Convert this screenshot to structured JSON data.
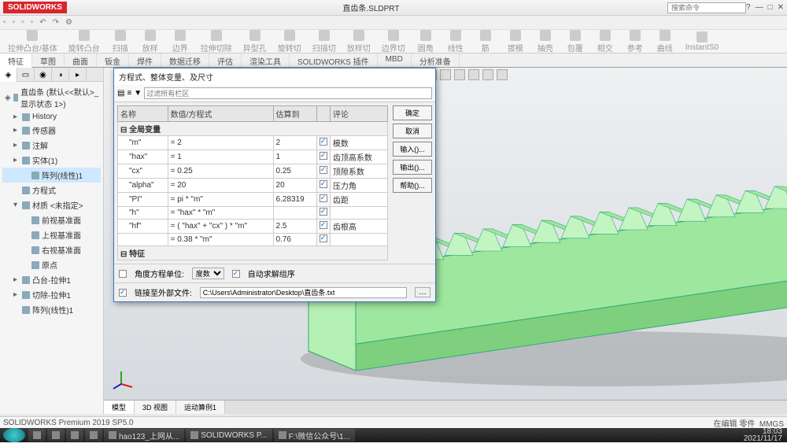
{
  "titlebar": {
    "logo": "SOLIDWORKS",
    "doc": "直齿条.SLDPRT",
    "search_ph": "搜索命令",
    "help": "?",
    "min": "—",
    "max": "□",
    "close": "✕"
  },
  "ribbon_tabs": [
    "特征",
    "草图",
    "曲面",
    "钣金",
    "焊件",
    "数据迁移",
    "评估",
    "渲染工具",
    "SOLIDWORKS 插件",
    "MBD",
    "分析准备"
  ],
  "active_tab": 0,
  "ribbon_btns": [
    "拉伸凸台/基体",
    "旋转凸台",
    "扫描",
    "放样",
    "边界",
    "拉伸切除",
    "异型孔",
    "旋转切",
    "扫描切",
    "放样切",
    "边界切",
    "圆角",
    "线性",
    "筋",
    "拔模",
    "抽壳",
    "包覆",
    "相交",
    "参考",
    "曲线",
    "InstantS0"
  ],
  "tree": [
    {
      "t": "◈",
      "l": "直齿条 (默认<<默认>_显示状态 1>)",
      "lvl": 0
    },
    {
      "t": "▸",
      "l": "History",
      "lvl": 1
    },
    {
      "t": "▸",
      "l": "传感器",
      "lvl": 1
    },
    {
      "t": "▸",
      "l": "注解",
      "lvl": 1
    },
    {
      "t": "▸",
      "l": "实体(1)",
      "lvl": 1
    },
    {
      "t": "",
      "l": "阵列(线性)1",
      "lvl": 2,
      "sel": true
    },
    {
      "t": "",
      "l": "方程式",
      "lvl": 1
    },
    {
      "t": "▾",
      "l": "材质 <未指定>",
      "lvl": 1
    },
    {
      "t": "",
      "l": "前视基准面",
      "lvl": 2
    },
    {
      "t": "",
      "l": "上视基准面",
      "lvl": 2
    },
    {
      "t": "",
      "l": "右视基准面",
      "lvl": 2
    },
    {
      "t": "",
      "l": "原点",
      "lvl": 2
    },
    {
      "t": "▸",
      "l": "凸台-拉伸1",
      "lvl": 1
    },
    {
      "t": "▸",
      "l": "切除-拉伸1",
      "lvl": 1
    },
    {
      "t": "",
      "l": "阵列(线性)1",
      "lvl": 1
    }
  ],
  "dialog": {
    "title": "方程式、整体变量、及尺寸",
    "filter_ph": "过滤所有栏区",
    "cols": [
      "名称",
      "数值/方程式",
      "估算到",
      "",
      "评论"
    ],
    "cat": "全局变量",
    "rows": [
      {
        "n": "\"m\"",
        "f": "= 2",
        "e": "2",
        "ok": true,
        "c": "模数"
      },
      {
        "n": "\"hax\"",
        "f": "= 1",
        "e": "1",
        "ok": true,
        "c": "齿顶高系数"
      },
      {
        "n": "\"cx\"",
        "f": "= 0.25",
        "e": "0.25",
        "ok": true,
        "c": "顶隙系数"
      },
      {
        "n": "\"alpha\"",
        "f": "= 20",
        "e": "20",
        "ok": true,
        "c": "压力角"
      },
      {
        "n": "\"PI\"",
        "f": "= pi * \"m\"",
        "e": "6.28319",
        "ok": true,
        "c": "齿距"
      },
      {
        "n": "\"h\"",
        "f": "= \"hax\" * \"m\"",
        "e": "",
        "ok": true,
        "c": ""
      },
      {
        "n": "\"hf\"",
        "f": "= ( \"hax\" + \"cx\" ) * \"m\"",
        "e": "2.5",
        "ok": true,
        "c": "齿根高"
      },
      {
        "n": "",
        "f": "= 0.38 * \"m\"",
        "e": "0.76",
        "ok": true,
        "c": ""
      }
    ],
    "cat2": "特征",
    "btns": {
      "ok": "确定",
      "cancel": "取消",
      "import": "输入()...",
      "export": "输出()...",
      "help": "帮助()..."
    },
    "unit_lbl": "角度方程单位:",
    "unit_val": "度数",
    "auto": "自动求解组序",
    "auto_chk": true,
    "link": "链接至外部文件:",
    "link_chk": true,
    "link_path": "C:\\Users\\Administrator\\Desktop\\直齿条.txt"
  },
  "vp_tabs": [
    "模型",
    "3D 视图",
    "运动算例1"
  ],
  "status": {
    "left": "SOLIDWORKS Premium 2019 SP5.0",
    "right": "在编辑 零件",
    "mmgs": "MMGS"
  },
  "taskbar": {
    "items": [
      "",
      "",
      "",
      "",
      "hao123_上网从...",
      "SOLIDWORKS P...",
      "F:\\微信公众号\\1..."
    ],
    "time": "18:03",
    "date": "2021/11/17"
  }
}
